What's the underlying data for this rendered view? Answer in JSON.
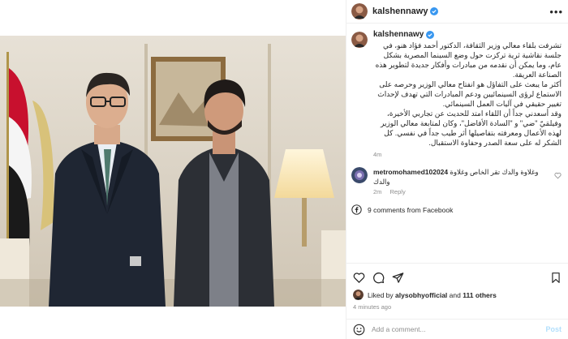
{
  "post": {
    "username": "kalshennawy",
    "caption": [
      "تشرفت بلقاء معالي وزير الثقافة، الدكتور أحمد فؤاد هنو، في جلسة نقاشية ثرية تركزت حول وضع السينما المصرية بشكل عام، وما يمكن أن نقدمه من مبادرات وأفكار جديدة لتطوير هذه الصناعة العريقة.",
      "أكثر ما يبعث على التفاؤل هو انفتاح معالي الوزير وحرصه على الاستماع لرؤى السينمائيين ودعم المبادرات التي تهدف لإحداث تغيير حقيقي في آليات العمل السينمائي.",
      "وقد أسعدني جداً أن اللقاء امتد للحديث عن تجاربي الأخيرة، وفيلمَيّ \"ضي\" و \"السادة الأفاضل\"، وكان لمتابعة معالي الوزير لهذه الأعمال ومعرفته بتفاصيلها أثر طيب جداً في نفسي. كل الشكر له على سعة الصدر وحفاوة الاستقبال."
    ],
    "caption_time": "4m"
  },
  "comments": [
    {
      "username": "metromohamed102024",
      "text": "وغلاوة والدك تقر الخاص وغلاوة والدك",
      "time": "2m",
      "reply_label": "Reply"
    }
  ],
  "facebook_comments": "9 comments from Facebook",
  "likes": {
    "prefix": "Liked by",
    "user": "alysobhyofficial",
    "middle": "and",
    "others": "111 others"
  },
  "posted_ago": "4 minutes ago",
  "add_comment": {
    "placeholder": "Add a comment...",
    "post_label": "Post"
  },
  "icons": {
    "more": "more-options-icon",
    "verified": "verified-badge-icon",
    "like": "heart-icon",
    "comment": "comment-bubble-icon",
    "share": "paper-plane-icon",
    "save": "bookmark-icon",
    "emoji": "emoji-smile-icon",
    "facebook": "facebook-icon"
  },
  "colors": {
    "verified": "#3897f0",
    "post_button": "#b2dffc",
    "muted_text": "#8e8e8e",
    "border": "#efefef"
  }
}
